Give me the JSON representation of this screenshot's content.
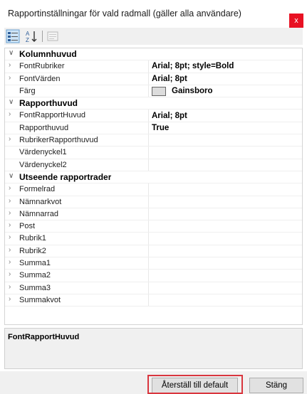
{
  "window": {
    "title": "Rapportinställningar för vald radmall (gäller alla användare)",
    "close_glyph": "x"
  },
  "toolbar": {
    "categorized_icon": "categorized-icon",
    "alphabetical_icon": "sort-alphabetical-icon",
    "property_pages_icon": "property-pages-icon"
  },
  "grid": {
    "categories": [
      {
        "label": "Kolumnhuvud",
        "rows": [
          {
            "name": "FontRubriker",
            "value": "Arial; 8pt; style=Bold",
            "expandable": true
          },
          {
            "name": "FontVärden",
            "value": "Arial; 8pt",
            "expandable": true
          },
          {
            "name": "Färg",
            "value": "Gainsboro",
            "swatch_color": "#DCDCDC",
            "expandable": false
          }
        ]
      },
      {
        "label": "Rapporthuvud",
        "rows": [
          {
            "name": "FontRapportHuvud",
            "value": "Arial; 8pt",
            "expandable": true
          },
          {
            "name": "Rapporthuvud",
            "value": "True",
            "expandable": false
          },
          {
            "name": "RubrikerRapporthuvud",
            "value": "",
            "expandable": true
          },
          {
            "name": "Värdenyckel1",
            "value": "",
            "expandable": false
          },
          {
            "name": "Värdenyckel2",
            "value": "",
            "expandable": false
          }
        ]
      },
      {
        "label": "Utseende rapportrader",
        "rows": [
          {
            "name": "Formelrad",
            "value": "",
            "expandable": true
          },
          {
            "name": "Nämnarkvot",
            "value": "",
            "expandable": true
          },
          {
            "name": "Nämnarrad",
            "value": "",
            "expandable": true
          },
          {
            "name": "Post",
            "value": "",
            "expandable": true
          },
          {
            "name": "Rubrik1",
            "value": "",
            "expandable": true
          },
          {
            "name": "Rubrik2",
            "value": "",
            "expandable": true
          },
          {
            "name": "Summa1",
            "value": "",
            "expandable": true
          },
          {
            "name": "Summa2",
            "value": "",
            "expandable": true
          },
          {
            "name": "Summa3",
            "value": "",
            "expandable": true
          },
          {
            "name": "Summakvot",
            "value": "",
            "expandable": true
          }
        ]
      }
    ]
  },
  "description": {
    "title": "FontRapportHuvud"
  },
  "buttons": {
    "reset": "Återställ till default",
    "close": "Stäng"
  },
  "colors": {
    "close_button": "#E81123",
    "highlight_border": "#D9363E"
  }
}
